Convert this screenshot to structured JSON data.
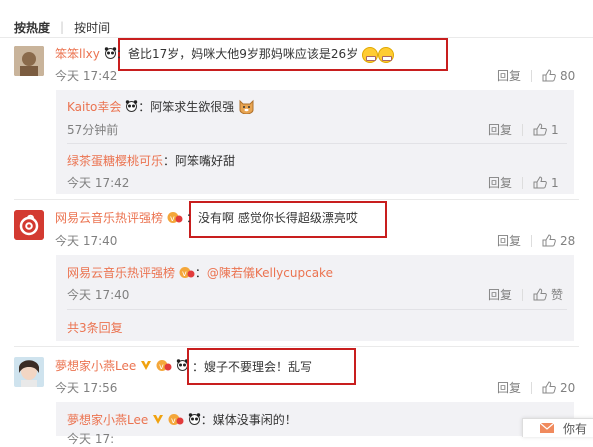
{
  "sort": {
    "hot": "按热度",
    "time": "按时间"
  },
  "labels": {
    "reply": "回复",
    "like_text": "赞",
    "more_replies": "共3条回复",
    "colon": "："
  },
  "comments": [
    {
      "user": "笨笨llxy",
      "text": "爸比17岁，妈咪大他9岁那妈咪应该是26岁",
      "time": "今天 17:42",
      "likes": "80",
      "replies": [
        {
          "user": "Kaito幸会",
          "text": "阿笨求生欲很强",
          "time": "57分钟前",
          "likes": "1"
        },
        {
          "user": "绿茶蛋糖樱桃可乐",
          "text": "阿笨嘴好甜",
          "time": "今天 17:42",
          "likes": "1"
        }
      ]
    },
    {
      "user": "网易云音乐热评强榜",
      "text": "没有啊  感觉你长得超级漂亮哎",
      "time": "今天 17:40",
      "likes": "28",
      "replies": [
        {
          "user": "网易云音乐热评强榜",
          "text": "@陳若儀Kellycupcake",
          "time": "今天 17:40",
          "likes": "赞"
        }
      ]
    },
    {
      "user": "夢想家小燕Lee",
      "text": "嫂子不要理会！乱写",
      "time": "今天 17:56",
      "likes": "20",
      "replies": [
        {
          "user": "夢想家小燕Lee",
          "text": "媒体没事闲的！",
          "time": "今天 17:",
          "likes": ""
        }
      ]
    }
  ],
  "popup": {
    "text": "你有"
  },
  "colors": {
    "name": "#eb7350",
    "highlight_box": "#c81e1e",
    "subbox_bg": "#f2f2f5"
  }
}
